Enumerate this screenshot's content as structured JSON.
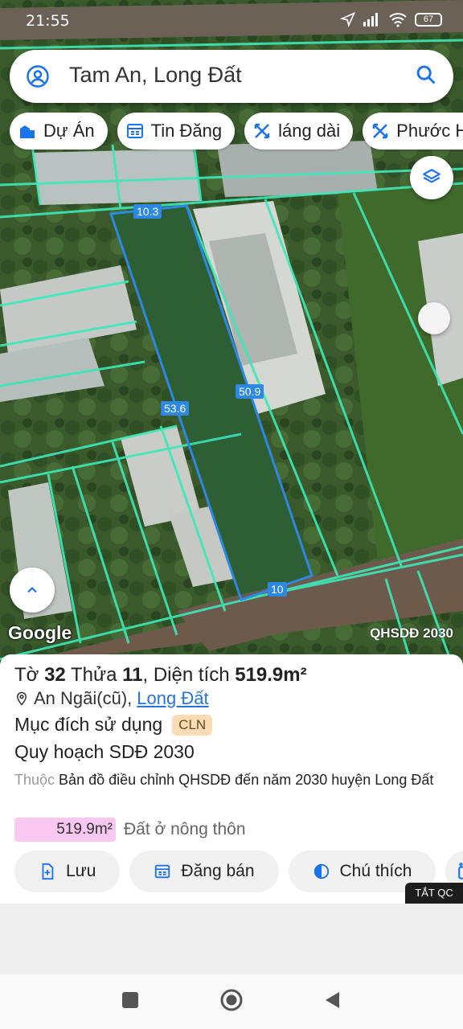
{
  "status": {
    "time": "21:55",
    "battery": "67"
  },
  "search": {
    "query": "Tam An, Long Đất"
  },
  "chips": [
    {
      "label": "Dự Án",
      "icon": "building-icon"
    },
    {
      "label": "Tin Đăng",
      "icon": "listing-icon"
    },
    {
      "label": "láng dài",
      "icon": "tool-icon"
    },
    {
      "label": "Phước Hả",
      "icon": "tool-icon"
    }
  ],
  "map": {
    "attribution": "Google",
    "overlay_label": "QHSDĐ 2030",
    "dimensions": {
      "top": "10.3",
      "left": "53.6",
      "right": "50.9",
      "bottom": "10"
    }
  },
  "parcel": {
    "to_label": "Tờ",
    "to": "32",
    "thua_label": "Thửa",
    "thua": "11",
    "dientich_label": "Diện tích",
    "area": "519.9m²",
    "location_prefix": "An Ngãi(cũ),",
    "location_link": "Long Đất",
    "purpose_label": "Mục đích sử dụng",
    "purpose_code": "CLN",
    "plan": "Quy hoạch SDĐ 2030",
    "belongs_prefix": "Thuộc",
    "belongs_text": "Bản đồ điều chỉnh QHSDĐ đến năm 2030 huyện Long Đất",
    "area_value": "519.9m²",
    "area_type": "Đất ở nông thôn"
  },
  "actions": [
    {
      "label": "Lưu"
    },
    {
      "label": "Đăng bán"
    },
    {
      "label": "Chú thích"
    }
  ],
  "ad_toggle": "TẮT QC",
  "colors": {
    "accent": "#2a74d6",
    "parcel_highlight": "#2d88e3",
    "parcel_lines": "#3ee8b8"
  }
}
